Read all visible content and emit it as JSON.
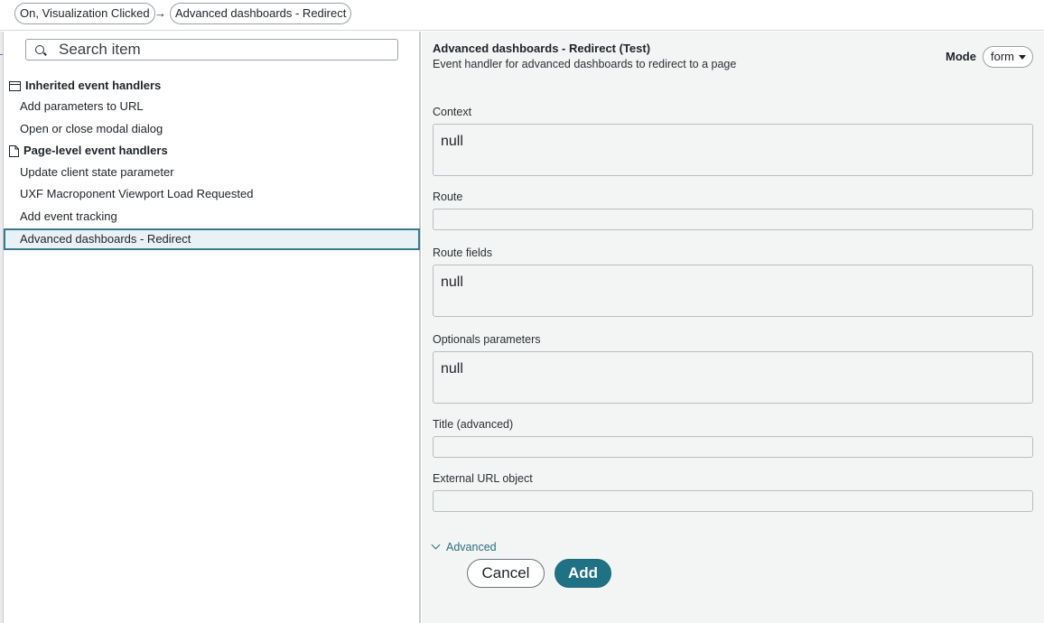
{
  "breadcrumb": {
    "items": [
      "On, Visualization Clicked",
      "Advanced dashboards - Redirect"
    ],
    "separator": "→"
  },
  "sidebar": {
    "search": {
      "placeholder": "Search item",
      "value": ""
    },
    "groups": [
      {
        "label": "Inherited event handlers",
        "icon": "window-icon",
        "items": [
          "Add parameters to URL",
          "Open or close modal dialog"
        ]
      },
      {
        "label": "Page-level event handlers",
        "icon": "page-icon",
        "items": [
          "Update client state parameter",
          "UXF Macroponent Viewport Load Requested",
          "Add event tracking",
          "Advanced dashboards - Redirect"
        ]
      }
    ],
    "selected": "Advanced dashboards - Redirect"
  },
  "detail": {
    "title": "Advanced dashboards - Redirect (Test)",
    "subtitle": "Event handler for advanced dashboards to redirect to a page",
    "mode_label": "Mode",
    "mode_value": "form",
    "fields": [
      {
        "label": "Context",
        "value": "null"
      },
      {
        "label": "Route",
        "value": ""
      },
      {
        "label": "Route fields",
        "value": "null"
      },
      {
        "label": "Optionals parameters",
        "value": "null"
      },
      {
        "label": "Title (advanced)",
        "value": ""
      },
      {
        "label": "External URL object",
        "value": ""
      }
    ],
    "advanced_label": "Advanced"
  },
  "actions": {
    "cancel": "Cancel",
    "add": "Add"
  },
  "colors": {
    "accent": "#1f7283",
    "selected_border": "#3a7a8f",
    "link": "#2a6f80"
  }
}
